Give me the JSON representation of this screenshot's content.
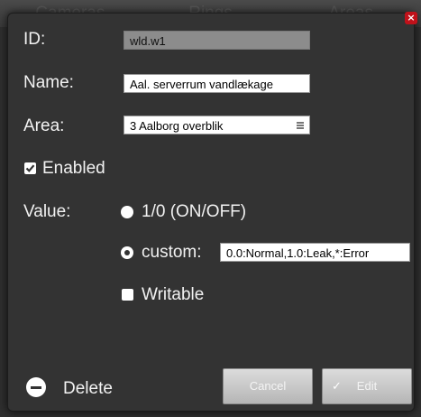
{
  "background_tabs": [
    "Cameras",
    "Rings",
    "Areas"
  ],
  "dialog": {
    "close_label": "×",
    "id_label": "ID:",
    "id_value": "wld.w1",
    "name_label": "Name:",
    "name_value": "Aal. serverrum vandlækage",
    "area_label": "Area:",
    "area_value": "3 Aalborg overblik",
    "enabled_label": "Enabled",
    "enabled_checked": true,
    "value_label": "Value:",
    "option_onoff_label": "1/0 (ON/OFF)",
    "option_custom_label": "custom:",
    "custom_value": "0.0:Normal,1.0:Leak,*:Error",
    "writable_label": "Writable",
    "writable_checked": false,
    "delete_label": "Delete",
    "cancel_label": "Cancel",
    "edit_label": "Edit"
  }
}
